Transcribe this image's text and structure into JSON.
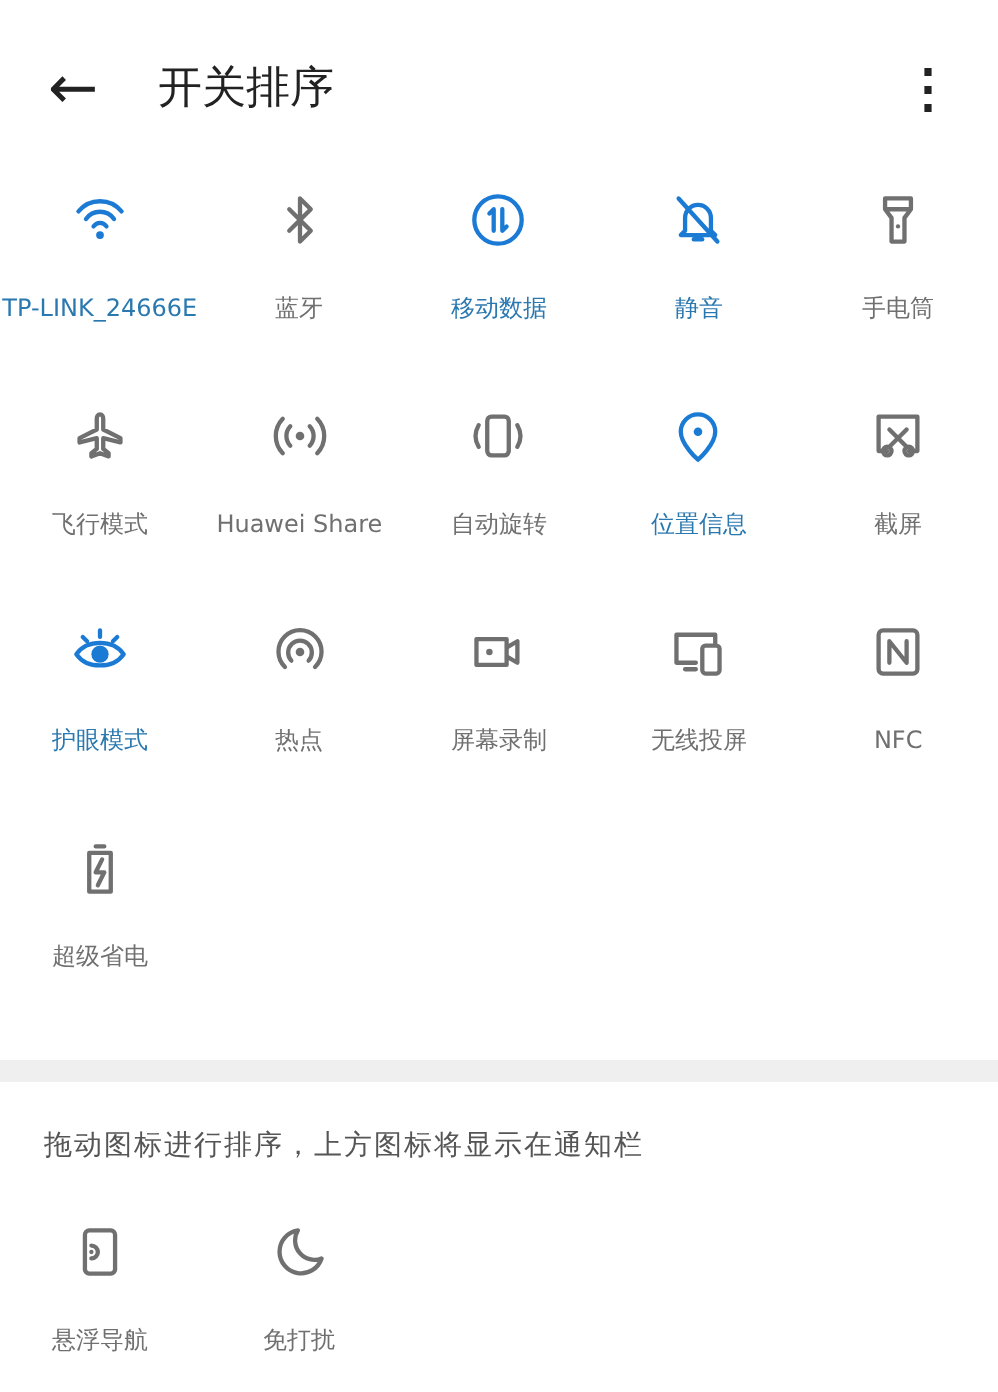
{
  "header": {
    "back": "←",
    "title": "开关排序",
    "menu": "⋮"
  },
  "tiles": [
    {
      "kind": "wifi",
      "label": "TP-LINK_24666E",
      "on": true
    },
    {
      "kind": "bluetooth",
      "label": "蓝牙",
      "on": false
    },
    {
      "kind": "data",
      "label": "移动数据",
      "on": true
    },
    {
      "kind": "mute",
      "label": "静音",
      "on": true
    },
    {
      "kind": "flashlight",
      "label": "手电筒",
      "on": false
    },
    {
      "kind": "airplane",
      "label": "飞行模式",
      "on": false
    },
    {
      "kind": "share",
      "label": "Huawei Share",
      "on": false
    },
    {
      "kind": "rotate",
      "label": "自动旋转",
      "on": false
    },
    {
      "kind": "location",
      "label": "位置信息",
      "on": true
    },
    {
      "kind": "screenshot",
      "label": "截屏",
      "on": false
    },
    {
      "kind": "eye",
      "label": "护眼模式",
      "on": true
    },
    {
      "kind": "hotspot",
      "label": "热点",
      "on": false
    },
    {
      "kind": "record",
      "label": "屏幕录制",
      "on": false
    },
    {
      "kind": "cast",
      "label": "无线投屏",
      "on": false
    },
    {
      "kind": "nfc",
      "label": "NFC",
      "on": false
    },
    {
      "kind": "battery",
      "label": "超级省电",
      "on": false
    }
  ],
  "hint": "拖动图标进行排序，上方图标将显示在通知栏",
  "hidden_tiles": [
    {
      "kind": "float",
      "label": "悬浮导航",
      "on": false
    },
    {
      "kind": "moon",
      "label": "免打扰",
      "on": false
    }
  ]
}
